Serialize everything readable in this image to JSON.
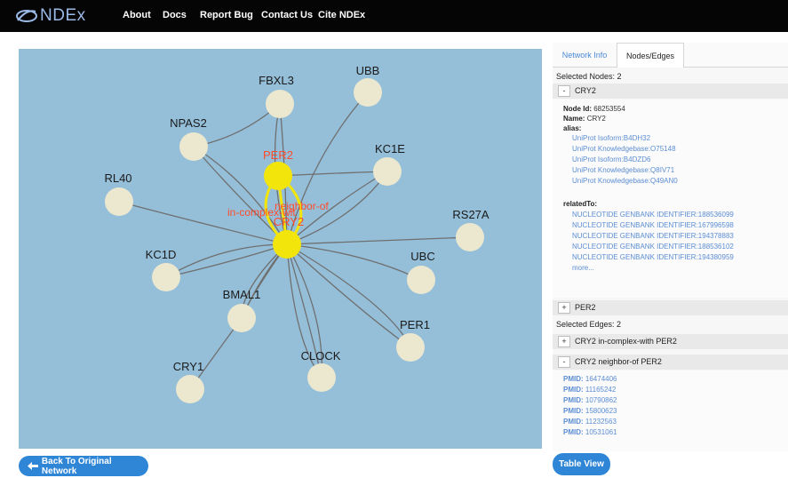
{
  "nav": {
    "logo_text": "NDEx",
    "items": [
      "About",
      "Docs",
      "Report Bug",
      "Contact Us",
      "Cite NDEx"
    ]
  },
  "graph": {
    "center": {
      "label": "CRY2"
    },
    "selected_neighbor": {
      "label": "PER2"
    },
    "nodes": [
      "FBXL3",
      "UBB",
      "NPAS2",
      "KC1E",
      "RL40",
      "RS27A",
      "KC1D",
      "UBC",
      "BMAL1",
      "PER1",
      "CLOCK",
      "CRY1"
    ],
    "edge_labels": [
      "in-complex-wit",
      "neighbor-of"
    ],
    "colors": {
      "background": "#95bfd9",
      "node": "#ece7cf",
      "selected_node": "#f2e50b",
      "edge": "#6f6f6f",
      "selected_label": "#ff4b2b"
    }
  },
  "buttons": {
    "back": "Back To Original Network",
    "table_view": "Table View"
  },
  "panel": {
    "tabs": [
      "Network Info",
      "Nodes/Edges"
    ],
    "selected_nodes_title": "Selected Nodes: 2",
    "node1": {
      "toggle": "-",
      "label": "CRY2",
      "node_id_key": "Node Id:",
      "node_id": "68253554",
      "name_key": "Name:",
      "name": "CRY2",
      "alias_key": "alias:",
      "aliases": [
        "UniProt Isoform:B4DH32",
        "UniProt Knowledgebase:O75148",
        "UniProt Isoform:B4DZD6",
        "UniProt Knowledgebase:Q8IV71",
        "UniProt Knowledgebase:Q49AN0"
      ],
      "related_key": "relatedTo:",
      "related": [
        "NUCLEOTIDE GENBANK IDENTIFIER:188536099",
        "NUCLEOTIDE GENBANK IDENTIFIER:167996598",
        "NUCLEOTIDE GENBANK IDENTIFIER:194378883",
        "NUCLEOTIDE GENBANK IDENTIFIER:188536102",
        "NUCLEOTIDE GENBANK IDENTIFIER:194380959"
      ],
      "more": "more..."
    },
    "node2": {
      "toggle": "+",
      "label": "PER2"
    },
    "selected_edges_title": "Selected Edges: 2",
    "edge1": {
      "toggle": "+",
      "label": "CRY2 in-complex-with PER2"
    },
    "edge2": {
      "toggle": "-",
      "label": "CRY2 neighbor-of PER2"
    },
    "pmid_key": "PMID:",
    "pmids": [
      "16474406",
      "11165242",
      "10790862",
      "15800623",
      "11232563",
      "10531061"
    ]
  }
}
